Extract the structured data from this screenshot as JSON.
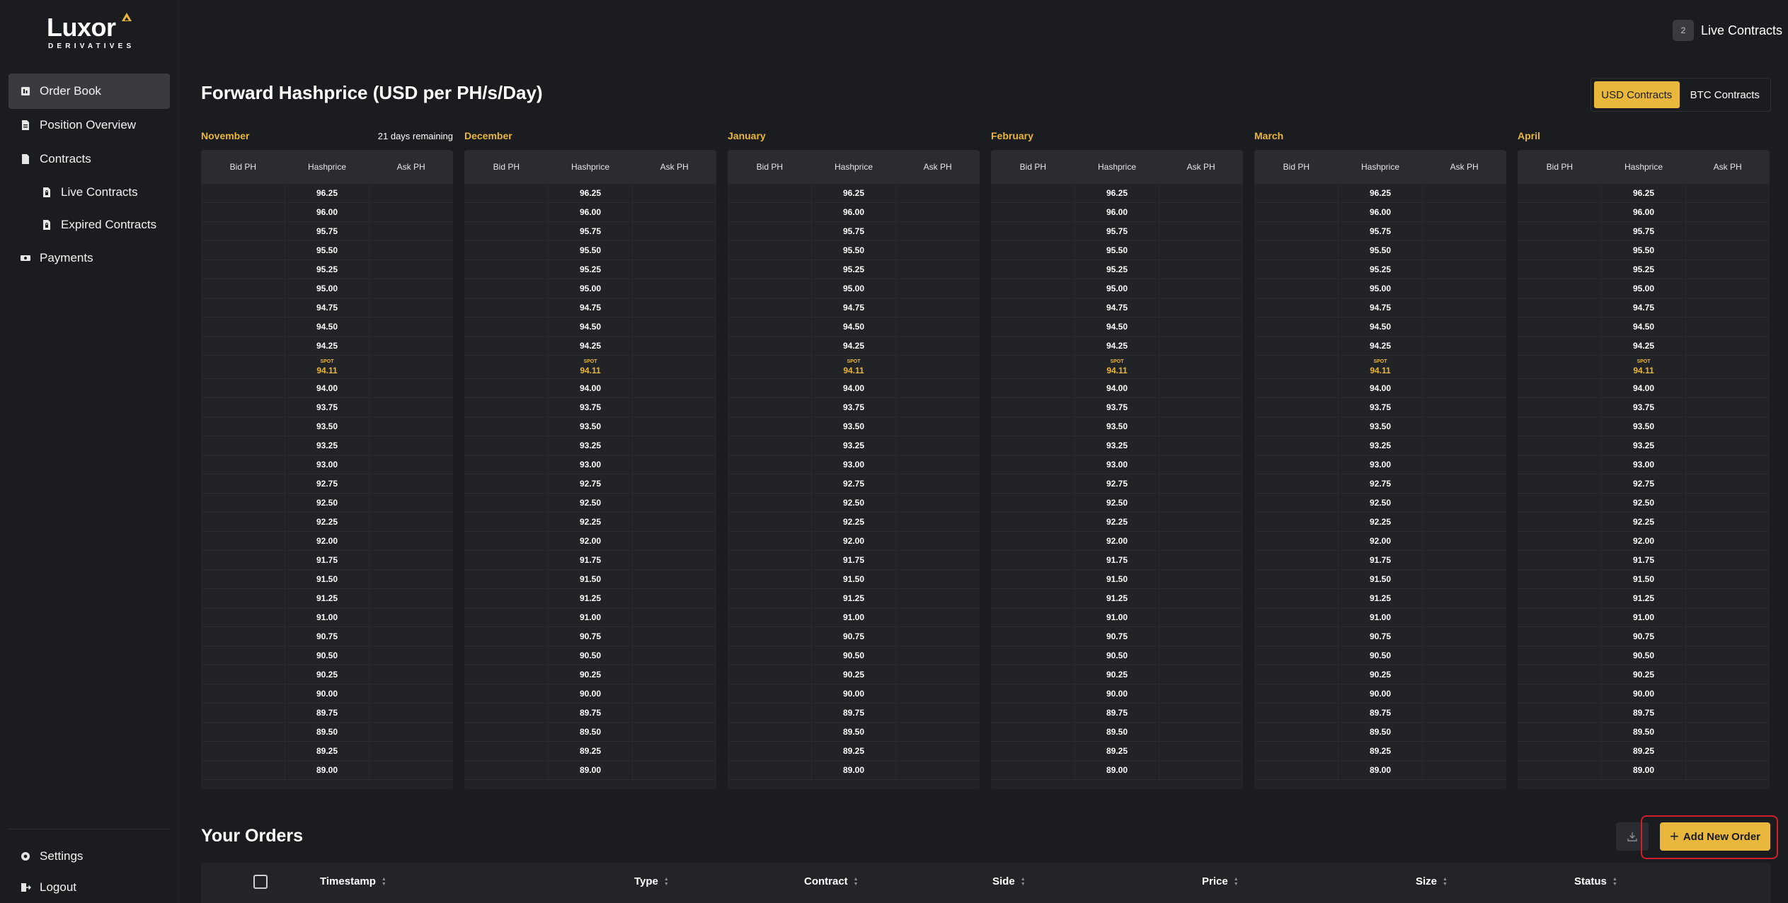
{
  "brand": {
    "name": "Luxor",
    "subtitle": "DERIVATIVES"
  },
  "sidebar": {
    "items": [
      {
        "label": "Order Book",
        "icon": "order-book-icon",
        "active": true
      },
      {
        "label": "Position Overview",
        "icon": "document-icon"
      },
      {
        "label": "Contracts",
        "icon": "file-icon"
      },
      {
        "label": "Live Contracts",
        "icon": "file-lock-icon",
        "sub": true
      },
      {
        "label": "Expired Contracts",
        "icon": "file-lock-icon",
        "sub": true
      },
      {
        "label": "Payments",
        "icon": "payments-icon"
      }
    ],
    "bottom": [
      {
        "label": "Settings",
        "icon": "gear-icon"
      },
      {
        "label": "Logout",
        "icon": "logout-icon"
      }
    ]
  },
  "header": {
    "live_count": "2",
    "live_label": "Live Contracts",
    "title": "Forward Hashprice (USD per PH/s/Day)",
    "toggle": {
      "usd": "USD Contracts",
      "btc": "BTC Contracts"
    }
  },
  "book": {
    "columns": {
      "bid": "Bid PH",
      "hash": "Hashprice",
      "ask": "Ask PH"
    },
    "spot_tag": "SPOT",
    "spot_value": "94.11",
    "months": [
      {
        "name": "November",
        "note": "21 days remaining"
      },
      {
        "name": "December",
        "note": ""
      },
      {
        "name": "January",
        "note": ""
      },
      {
        "name": "February",
        "note": ""
      },
      {
        "name": "March",
        "note": ""
      },
      {
        "name": "April",
        "note": ""
      }
    ],
    "prices_above": [
      "96.25",
      "96.00",
      "95.75",
      "95.50",
      "95.25",
      "95.00",
      "94.75",
      "94.50",
      "94.25"
    ],
    "prices_below": [
      "94.00",
      "93.75",
      "93.50",
      "93.25",
      "93.00",
      "92.75",
      "92.50",
      "92.25",
      "92.00",
      "91.75",
      "91.50",
      "91.25",
      "91.00",
      "90.75",
      "90.50",
      "90.25",
      "90.00",
      "89.75",
      "89.50",
      "89.25",
      "89.00"
    ]
  },
  "orders": {
    "title": "Your Orders",
    "add_label": "Add New Order",
    "columns": [
      "Timestamp",
      "Type",
      "Contract",
      "Side",
      "Price",
      "Size",
      "Status"
    ]
  },
  "colors": {
    "accent": "#e8b73b",
    "background": "#1b1c1f",
    "highlight": "#d21f2c"
  }
}
